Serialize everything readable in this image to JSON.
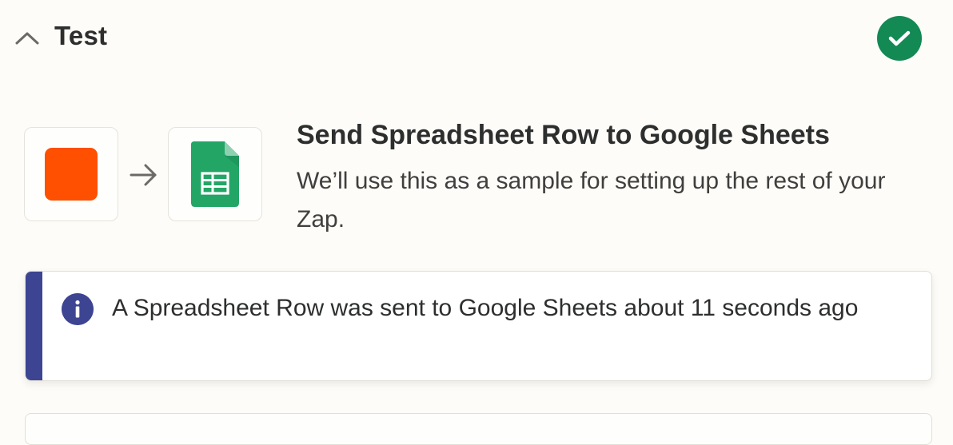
{
  "section": {
    "title": "Test",
    "status": "success"
  },
  "step": {
    "title": "Send Spreadsheet Row to Google Sheets",
    "description": "We’ll use this as a sample for setting up the rest of your Zap.",
    "trigger_app_icon": "zapier-orange-square-icon",
    "action_app_icon": "google-sheets-icon"
  },
  "notice": {
    "text": "A Spreadsheet Row was sent to Google Sheets about 11 seconds ago",
    "icon": "info-icon"
  },
  "colors": {
    "success": "#138954",
    "brand_orange": "#ff4f00",
    "sheets_green": "#23a566",
    "info_accent": "#3d4592",
    "background": "#fdfcf8"
  }
}
